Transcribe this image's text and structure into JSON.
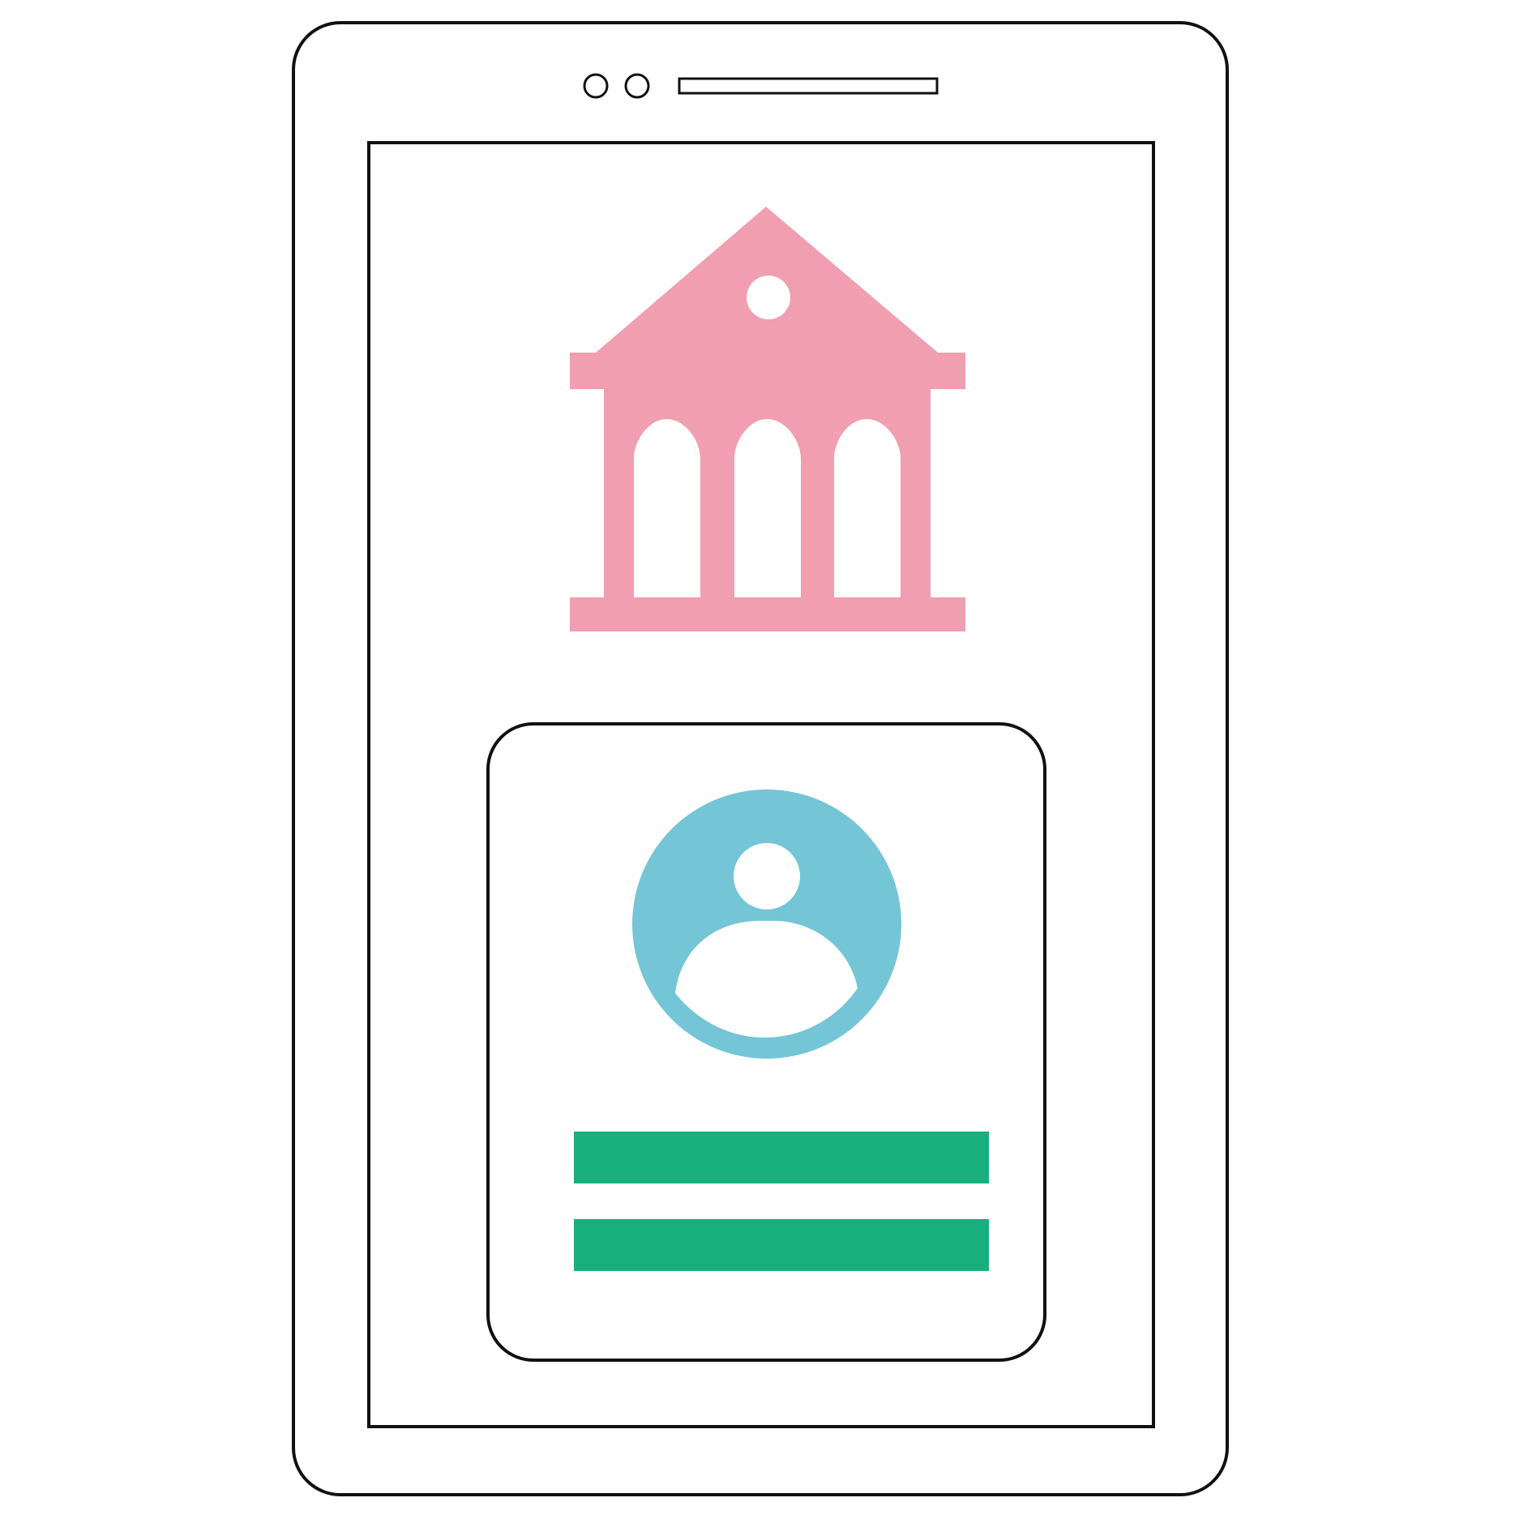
{
  "colors": {
    "outline": "#111111",
    "background": "#ffffff",
    "bank_icon": "#F19EB0",
    "avatar": "#74C5D6",
    "text_lines": "#17B07D"
  },
  "icons": {
    "bank": "bank-building-icon",
    "user": "user-avatar-icon",
    "camera": "camera-dot-icon",
    "speaker": "speaker-slot-icon"
  },
  "id_card": {
    "text_lines_count": 2
  }
}
